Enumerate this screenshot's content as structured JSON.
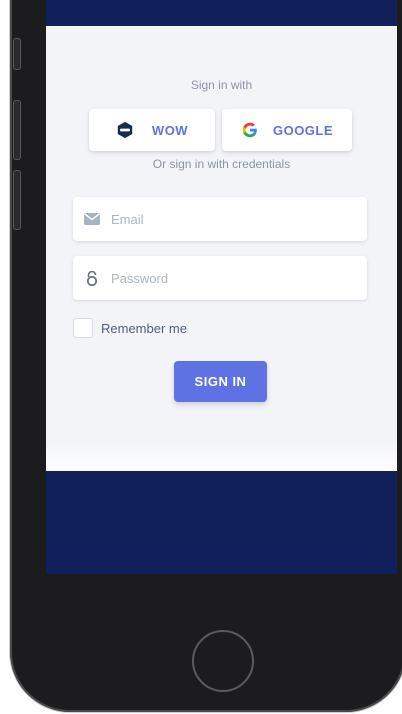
{
  "login": {
    "sign_in_with": "Sign in with",
    "social": {
      "wow_label": "WOW",
      "google_label": "GOOGLE"
    },
    "or_credentials": "Or sign in with credentials",
    "email_placeholder": "Email",
    "password_placeholder": "Password",
    "remember_label": "Remember me",
    "submit_label": "SIGN IN"
  },
  "colors": {
    "primary": "#5e72e4",
    "navy": "#11205a",
    "card": "#f3f4f7",
    "muted": "#8a94a6"
  },
  "icons": [
    "wow-logo-icon",
    "google-icon",
    "envelope-icon",
    "lock-icon"
  ]
}
